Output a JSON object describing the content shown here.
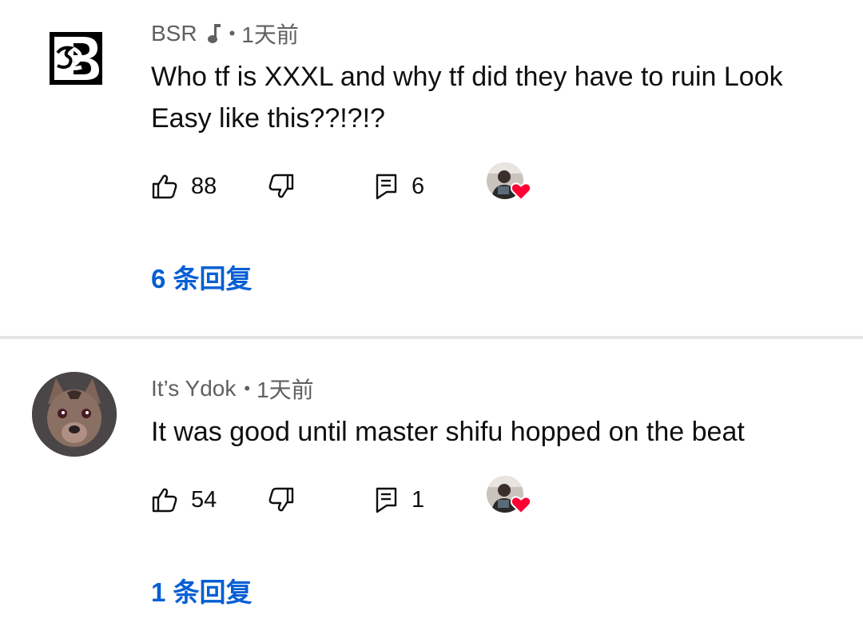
{
  "comments": [
    {
      "author": "BSR",
      "author_badge_icon": "music-note-icon",
      "separator": "•",
      "time": "1天前",
      "text": "Who tf is XXXL and why tf did they have to ruin Look Easy like this??!?!?",
      "likes": "88",
      "replies_count": "6",
      "replies_link": "6 条回复",
      "creator_hearted": true
    },
    {
      "author": "It’s Ydok",
      "separator": "•",
      "time": "1天前",
      "text": "It was good until master shifu hopped on the beat",
      "likes": "54",
      "replies_count": "1",
      "replies_link": "1 条回复",
      "creator_hearted": true
    }
  ],
  "colors": {
    "link_blue": "#065fd4",
    "heart_red": "#ff0033",
    "meta_gray": "#606060",
    "divider": "#e5e5e5"
  }
}
